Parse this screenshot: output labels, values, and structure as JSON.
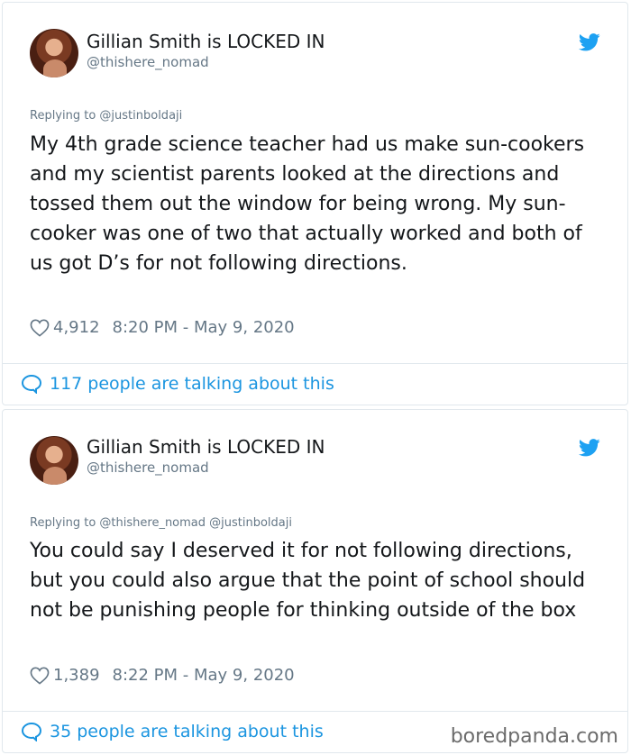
{
  "tweets": [
    {
      "author_name": "Gillian Smith is LOCKED IN",
      "handle": "@thishere_nomad",
      "replying_to": "Replying to @justinboldaji",
      "text": "My 4th grade science teacher had us make sun-cookers and my scientist parents looked at the directions and tossed them out the window for being wrong. My sun-cooker was one of two that actually worked and both of us got D’s for not following directions.",
      "likes": "4,912",
      "timestamp": "8:20 PM - May 9, 2020",
      "talking": "117 people are talking about this"
    },
    {
      "author_name": "Gillian Smith is LOCKED IN",
      "handle": "@thishere_nomad",
      "replying_to": "Replying to @thishere_nomad @justinboldaji",
      "text": "You could say I deserved it for not following directions, but you could also argue that the point of school should not be punishing people for thinking outside of the box",
      "likes": "1,389",
      "timestamp": "8:22 PM - May 9, 2020",
      "talking": "35 people are talking about this"
    }
  ],
  "watermark": "boredpanda.com",
  "colors": {
    "twitter_blue": "#1da1f2",
    "link_blue": "#1b95e0",
    "muted": "#657786"
  },
  "icons": [
    "twitter-bird-icon",
    "heart-icon",
    "speech-bubble-icon"
  ]
}
